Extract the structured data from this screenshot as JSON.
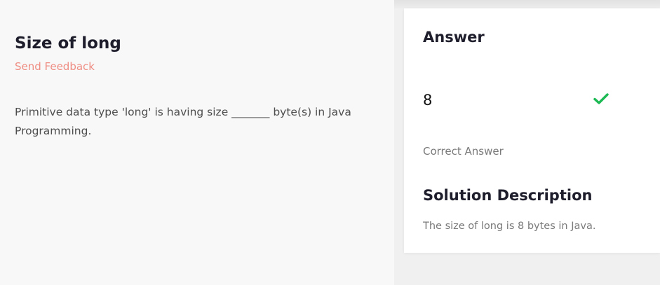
{
  "problem": {
    "title": "Size of long",
    "feedback_label": "Send Feedback",
    "question": "Primitive data type 'long' is having size _______ byte(s) in Java Programming."
  },
  "answer": {
    "heading": "Answer",
    "value": "8",
    "status_icon": "check-icon",
    "status_label": "Correct Answer",
    "status_color": "#1db954"
  },
  "solution": {
    "heading": "Solution Description",
    "text": "The size of long is 8 bytes in Java."
  },
  "colors": {
    "accent_link": "#ef8d83",
    "heading": "#1d1d2c"
  }
}
